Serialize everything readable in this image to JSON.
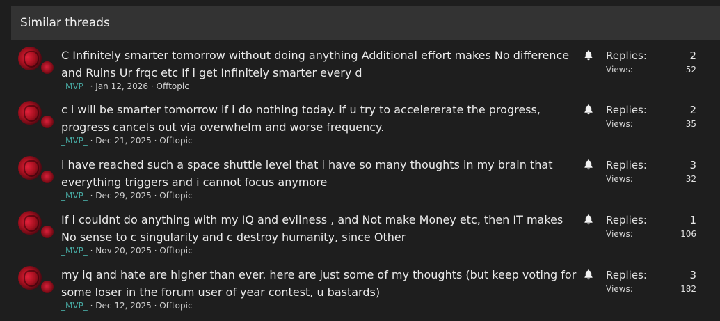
{
  "section": {
    "title": "Similar threads"
  },
  "labels": {
    "replies": "Replies:",
    "views": "Views:"
  },
  "threads": [
    {
      "title": "C Infinitely smarter tomorrow without doing anything Additional effort makes No difference and Ruins Ur frqc etc If i get Infinitely smarter every d",
      "author": "_MVP_",
      "date": "Jan 12, 2026",
      "forum": "Offtopic",
      "replies": "2",
      "views": "52"
    },
    {
      "title": "c i will be smarter tomorrow if i do nothing today. if u try to accelererate the progress, progress cancels out via overwhelm and worse frequency.",
      "author": "_MVP_",
      "date": "Dec 21, 2025",
      "forum": "Offtopic",
      "replies": "2",
      "views": "35"
    },
    {
      "title": "i have reached such a space shuttle level that i have so many thoughts in my brain that everything triggers and i cannot focus anymore",
      "author": "_MVP_",
      "date": "Dec 29, 2025",
      "forum": "Offtopic",
      "replies": "3",
      "views": "32"
    },
    {
      "title": "If i couldnt do anything with my IQ and evilness , and Not make Money etc, then IT makes No sense to c singularity and c destroy humanity, since Other",
      "author": "_MVP_",
      "date": "Nov 20, 2025",
      "forum": "Offtopic",
      "replies": "1",
      "views": "106"
    },
    {
      "title": "my iq and hate are higher than ever. here are just some of my thoughts (but keep voting for some loser in the forum user of year contest, u bastards)",
      "author": "_MVP_",
      "date": "Dec 12, 2025",
      "forum": "Offtopic",
      "replies": "3",
      "views": "182"
    }
  ]
}
